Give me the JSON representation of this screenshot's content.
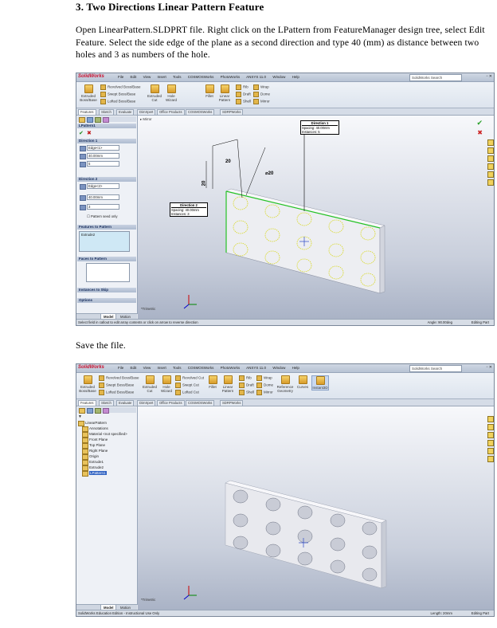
{
  "doc": {
    "heading": "3. Two Directions Linear Pattern Feature",
    "paragraph": "Open LinearPattern.SLDPRT file. Right click on the LPattern from FeatureManager design tree, select Edit Feature. Select the side edge of the plane as a second direction and type 40 (mm) as distance between two holes and 3 as numbers of the hole.",
    "save_text": "Save the file."
  },
  "app": {
    "logo": "SolidWorks",
    "menu": [
      "File",
      "Edit",
      "View",
      "Insert",
      "Tools",
      "COSMOSWorks",
      "PhotoWorks",
      "ANSYS 11.0",
      "Window",
      "Help"
    ],
    "search_placeholder": "SolidWorks Search",
    "tabs": [
      "Features",
      "Sketch",
      "Evaluate",
      "DimXpert",
      "Office Products",
      "COSMOSWorks",
      "SDRPWorks"
    ]
  },
  "shot1": {
    "ribbon_items": [
      "Extruded Boss/Base",
      "Revolved Boss/Base",
      "Swept Boss/Base",
      "Lofted Boss/Base",
      "Extruded Cut",
      "Hole Wizard",
      "Fillet",
      "Linear Pattern",
      "Rib",
      "Draft",
      "Shell",
      "Wrap",
      "Dome",
      "Mirror"
    ],
    "pm_title": "LPattern1",
    "direction1": {
      "header": "Direction 1",
      "edge": "Edge<1>",
      "spacing": "40.00mm",
      "count": "5"
    },
    "direction2": {
      "header": "Direction 2",
      "edge": "Edge<2>",
      "spacing": "40.00mm",
      "count": "3",
      "checkbox": "Pattern seed only"
    },
    "features_header": "Features to Pattern",
    "features_item": "Extrude2",
    "faces_header": "Faces to Pattern",
    "skip_header": "Instances to Skip",
    "options_header": "Options",
    "callout_dir1": {
      "title": "Direction 1",
      "spacing_label": "Spacing:",
      "spacing": "40.00mm",
      "instances_label": "Instances:",
      "instances": "5"
    },
    "callout_dir2": {
      "title": "Direction 2",
      "spacing_label": "Spacing:",
      "spacing": "40.00mm",
      "instances_label": "Instances:",
      "instances": "3"
    },
    "dim_a": "20",
    "dim_b": "20",
    "dim_c": "⌀20",
    "view_label": "*Trimetric",
    "status": "Select field in callout to edit array contents or click on arrow to reverse direction",
    "status_angle": "Angle: 90.00deg",
    "status_mode": "Editing Part",
    "bottom_tabs": [
      "Model",
      "Motion Study 1"
    ],
    "viewport_label": "Mirror"
  },
  "shot2": {
    "ribbon": [
      "Extruded Boss/Base",
      "Revolved Boss/Base",
      "Swept Boss/Base",
      "Lofted Boss/Base",
      "Extruded Cut",
      "Hole Wizard",
      "Revolved Cut",
      "Swept Cut",
      "Lofted Cut",
      "Fillet",
      "Linear Pattern",
      "Rib",
      "Draft",
      "Shell",
      "Wrap",
      "Dome",
      "Mirror",
      "Reference Geometry",
      "Curves",
      "Instant3D"
    ],
    "tree": [
      "LinearPattern",
      "Annotations",
      "Material <not specified>",
      "Front Plane",
      "Top Plane",
      "Right Plane",
      "Origin",
      "Extrude1",
      "Extrude2",
      "LPattern1"
    ],
    "status": "SolidWorks Education Edition - Instructional Use Only",
    "status_len": "Length: 20mm",
    "status_mode": "Editing Part",
    "view_label": "*Trimetric",
    "bottom_tabs": [
      "Model",
      "Motion Study 1"
    ]
  }
}
